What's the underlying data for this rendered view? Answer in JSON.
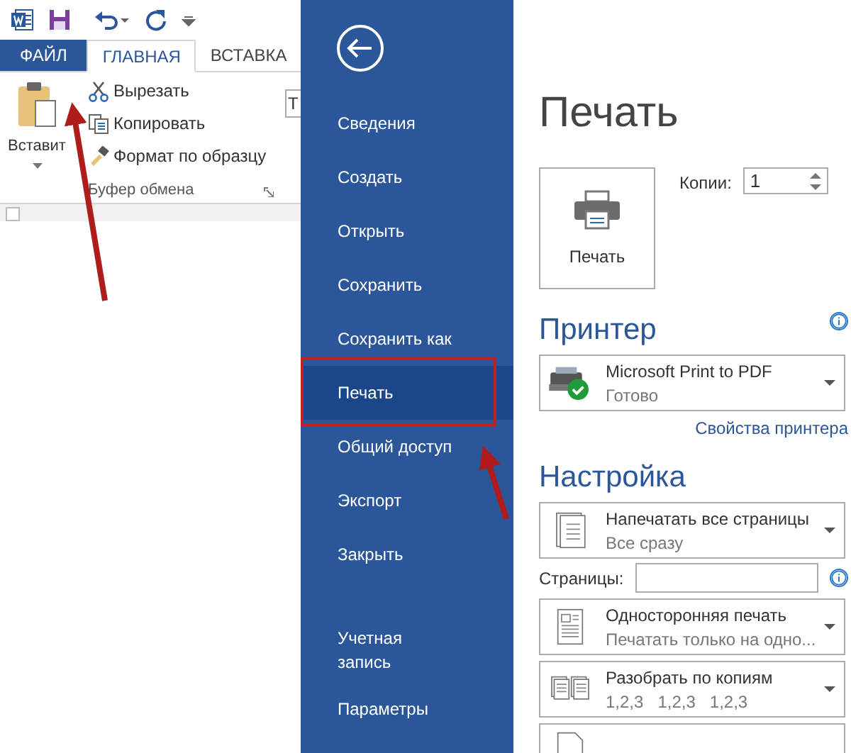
{
  "ribbon": {
    "tabs": [
      {
        "label": "ФАЙЛ",
        "kind": "file",
        "selected": false
      },
      {
        "label": "ГЛАВНАЯ",
        "kind": "tab",
        "selected": true
      },
      {
        "label": "ВСТАВКА",
        "kind": "tab",
        "selected": false
      }
    ],
    "paste_label": "Вставит",
    "clipboard_commands": [
      {
        "label": "Вырезать",
        "kind": "cut"
      },
      {
        "label": "Копировать",
        "kind": "copy"
      },
      {
        "label": "Формат по образцу",
        "kind": "format"
      }
    ],
    "group_label": "Буфер обмена",
    "font_field": "Т"
  },
  "backstage": {
    "menu": [
      {
        "label": "Сведения",
        "selected": false
      },
      {
        "label": "Создать",
        "selected": false
      },
      {
        "label": "Открыть",
        "selected": false
      },
      {
        "label": "Сохранить",
        "selected": false
      },
      {
        "label": "Сохранить как",
        "selected": false
      },
      {
        "label": "Печать",
        "selected": true
      },
      {
        "label": "Общий доступ",
        "selected": false
      },
      {
        "label": "Экспорт",
        "selected": false
      },
      {
        "label": "Закрыть",
        "selected": false
      }
    ],
    "footer_menu": [
      {
        "label": "Учетная запись",
        "selected": false
      },
      {
        "label": "Параметры",
        "selected": false
      }
    ]
  },
  "print": {
    "title": "Печать",
    "button_label": "Печать",
    "copies_label": "Копии:",
    "copies_value": "1",
    "printer_heading": "Принтер",
    "printer": {
      "name": "Microsoft Print to PDF",
      "status": "Готово"
    },
    "printer_properties": "Свойства принтера",
    "settings_heading": "Настройка",
    "settings": [
      {
        "kind": "all-pages",
        "title": "Напечатать все страницы",
        "subtitle": "Все сразу"
      },
      {
        "kind": "pages-field",
        "label": "Страницы:"
      },
      {
        "kind": "one-sided",
        "title": "Односторонняя печать",
        "subtitle": "Печатать только на одно..."
      },
      {
        "kind": "collated",
        "title": "Разобрать по копиям",
        "subtitle_parts": [
          "1,2,3",
          "1,2,3",
          "1,2,3"
        ]
      },
      {
        "kind": "partial"
      }
    ]
  }
}
